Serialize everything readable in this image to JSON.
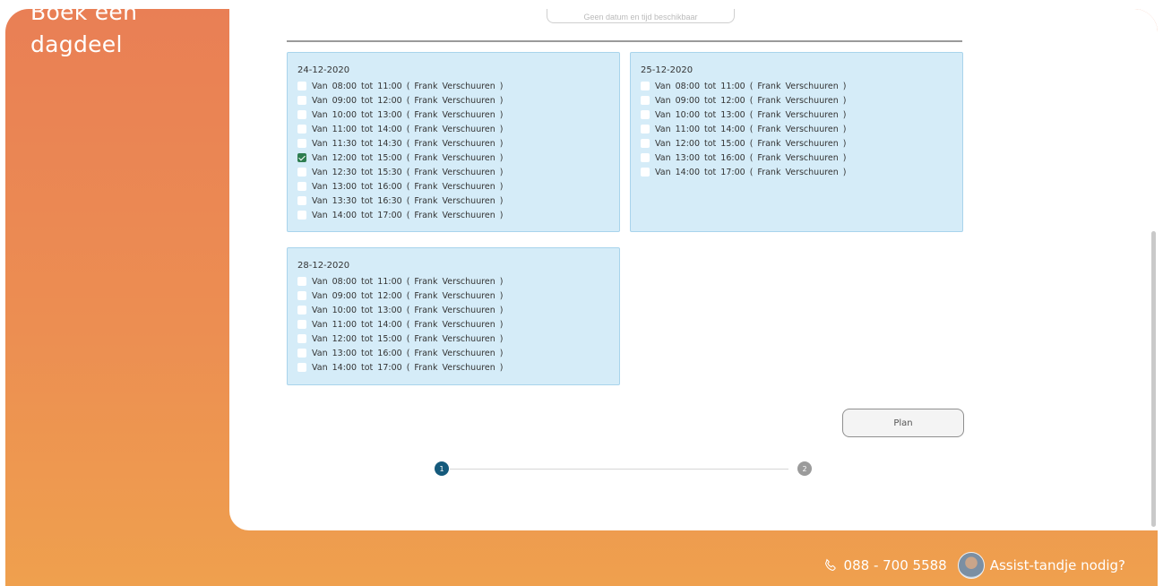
{
  "sidebar": {
    "title_line1": "Boek een",
    "title_line2": "dagdeel"
  },
  "top_input": {
    "text": "Geen datum en tijd beschikbaar"
  },
  "days": [
    {
      "date": "24-12-2020",
      "slots": [
        {
          "label": "Van  08:00  tot  11:00  ( Frank Verschuuren )",
          "checked": false
        },
        {
          "label": "Van  09:00  tot  12:00  ( Frank Verschuuren )",
          "checked": false
        },
        {
          "label": "Van  10:00  tot  13:00  ( Frank Verschuuren )",
          "checked": false
        },
        {
          "label": "Van  11:00  tot  14:00  ( Frank Verschuuren )",
          "checked": false
        },
        {
          "label": "Van  11:30  tot  14:30  ( Frank Verschuuren )",
          "checked": false
        },
        {
          "label": "Van  12:00  tot  15:00  ( Frank Verschuuren )",
          "checked": true
        },
        {
          "label": "Van  12:30  tot  15:30  ( Frank Verschuuren )",
          "checked": false
        },
        {
          "label": "Van  13:00  tot  16:00  ( Frank Verschuuren )",
          "checked": false
        },
        {
          "label": "Van  13:30  tot  16:30  ( Frank Verschuuren )",
          "checked": false
        },
        {
          "label": "Van  14:00  tot  17:00  ( Frank Verschuuren )",
          "checked": false
        }
      ]
    },
    {
      "date": "25-12-2020",
      "slots": [
        {
          "label": "Van  08:00  tot  11:00  ( Frank Verschuuren )",
          "checked": false
        },
        {
          "label": "Van  09:00  tot  12:00  ( Frank Verschuuren )",
          "checked": false
        },
        {
          "label": "Van  10:00  tot  13:00  ( Frank Verschuuren )",
          "checked": false
        },
        {
          "label": "Van  11:00  tot  14:00  ( Frank Verschuuren )",
          "checked": false
        },
        {
          "label": "Van  12:00  tot  15:00  ( Frank Verschuuren )",
          "checked": false
        },
        {
          "label": "Van  13:00  tot  16:00  ( Frank Verschuuren )",
          "checked": false
        },
        {
          "label": "Van  14:00  tot  17:00  ( Frank Verschuuren )",
          "checked": false
        }
      ]
    },
    {
      "date": "28-12-2020",
      "slots": [
        {
          "label": "Van  08:00  tot  11:00  ( Frank Verschuuren )",
          "checked": false
        },
        {
          "label": "Van  09:00  tot  12:00  ( Frank Verschuuren )",
          "checked": false
        },
        {
          "label": "Van  10:00  tot  13:00  ( Frank Verschuuren )",
          "checked": false
        },
        {
          "label": "Van  11:00  tot  14:00  ( Frank Verschuuren )",
          "checked": false
        },
        {
          "label": "Van  12:00  tot  15:00  ( Frank Verschuuren )",
          "checked": false
        },
        {
          "label": "Van  13:00  tot  16:00  ( Frank Verschuuren )",
          "checked": false
        },
        {
          "label": "Van  14:00  tot  17:00  ( Frank Verschuuren )",
          "checked": false
        }
      ]
    }
  ],
  "plan_button": {
    "label": "Plan"
  },
  "stepper": {
    "step1": "1",
    "step2": "2",
    "active": 1
  },
  "footer": {
    "phone": "088 - 700 5588",
    "help": "Assist-tandje nodig?",
    "phone_icon": "phone-icon",
    "avatar_icon": "avatar"
  },
  "colors": {
    "brand_orange": "#ec8e52",
    "card_bg": "#d5ecf8",
    "card_border": "#a9d4ec",
    "step_active": "#155a7c",
    "step_inactive": "#9b9b9b",
    "checked": "#2e7d4f"
  }
}
